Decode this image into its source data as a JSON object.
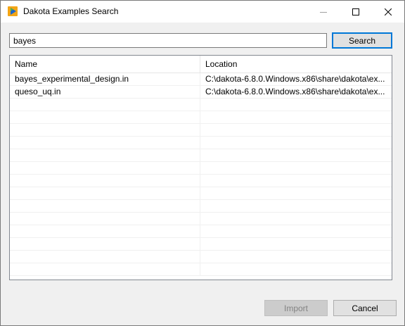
{
  "window": {
    "title": "Dakota Examples Search"
  },
  "search": {
    "query": "bayes",
    "button_label": "Search"
  },
  "table": {
    "columns": [
      "Name",
      "Location"
    ],
    "rows": [
      {
        "name": "bayes_experimental_design.in",
        "location": "C:\\dakota-6.8.0.Windows.x86\\share\\dakota\\ex..."
      },
      {
        "name": "queso_uq.in",
        "location": "C:\\dakota-6.8.0.Windows.x86\\share\\dakota\\ex..."
      },
      {
        "name": "",
        "location": ""
      },
      {
        "name": "",
        "location": ""
      },
      {
        "name": "",
        "location": ""
      },
      {
        "name": "",
        "location": ""
      },
      {
        "name": "",
        "location": ""
      },
      {
        "name": "",
        "location": ""
      },
      {
        "name": "",
        "location": ""
      },
      {
        "name": "",
        "location": ""
      },
      {
        "name": "",
        "location": ""
      },
      {
        "name": "",
        "location": ""
      },
      {
        "name": "",
        "location": ""
      },
      {
        "name": "",
        "location": ""
      },
      {
        "name": "",
        "location": ""
      },
      {
        "name": "",
        "location": ""
      }
    ]
  },
  "footer": {
    "import_label": "Import",
    "cancel_label": "Cancel"
  },
  "colors": {
    "focus_border": "#0078d7",
    "disabled_text": "#838383"
  }
}
